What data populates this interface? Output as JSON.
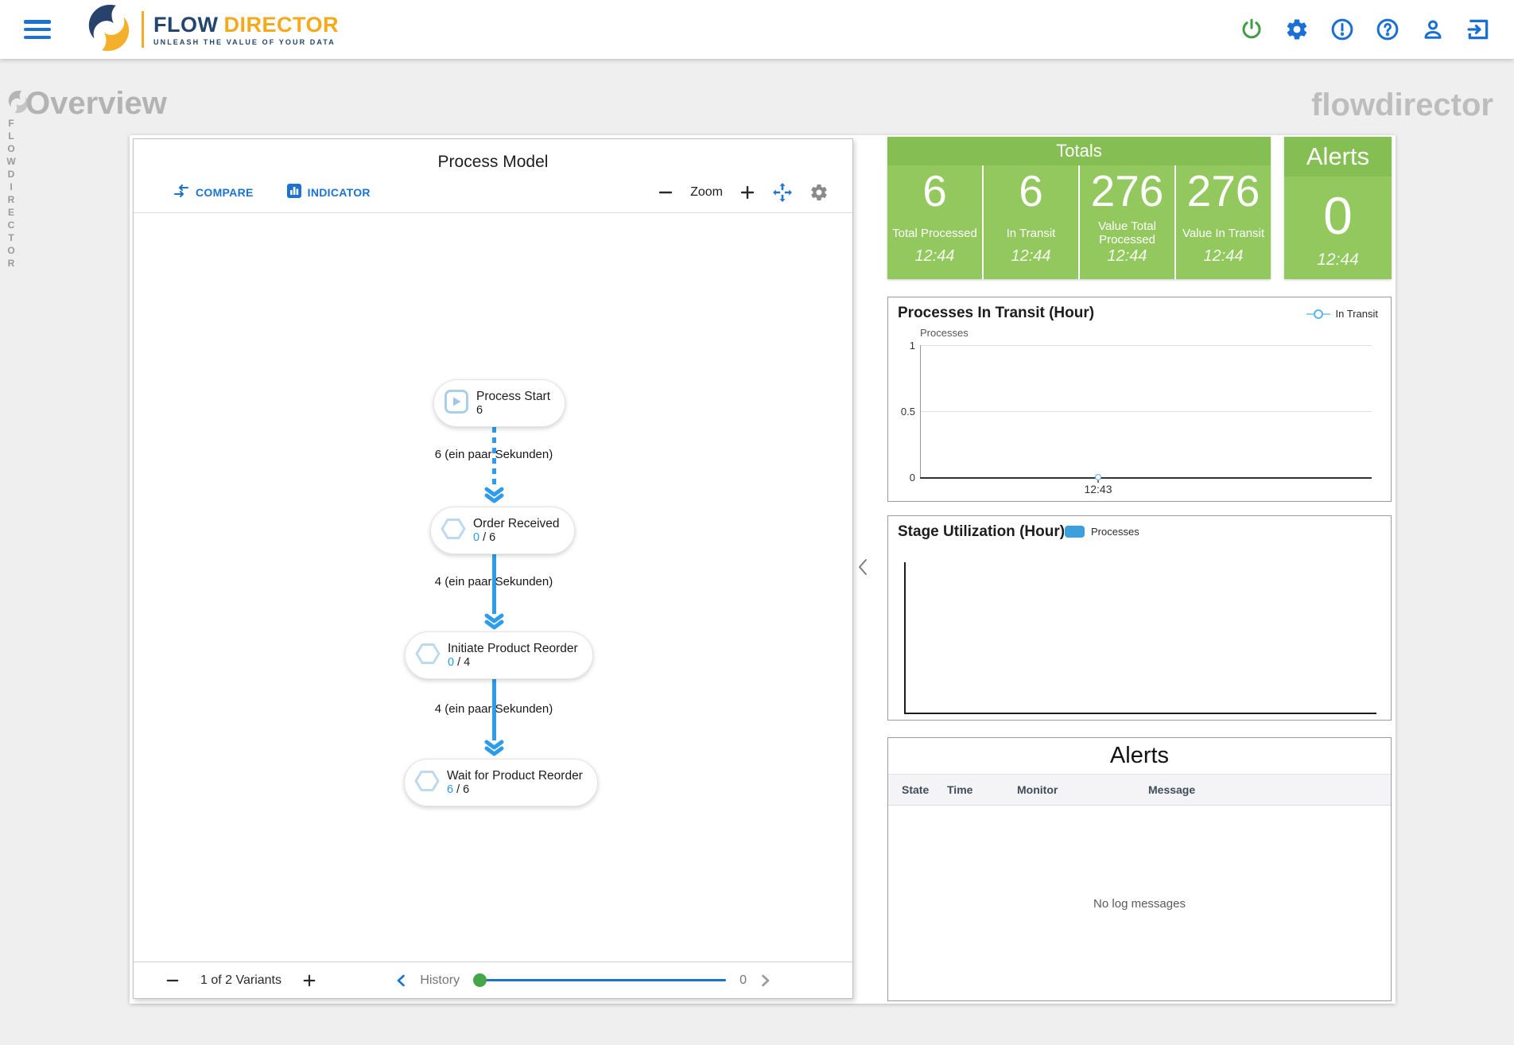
{
  "header": {
    "brand": {
      "word1": "FLOW",
      "word2": "DIRECTOR",
      "tagline": "UNLEASH THE VALUE OF YOUR DATA"
    },
    "action_icons": [
      "power",
      "settings",
      "alert",
      "help",
      "user",
      "logout"
    ]
  },
  "page": {
    "title": "Overview",
    "watermark": "flowdirector",
    "vertical_brand": "FLOWDIRECTOR"
  },
  "process_model": {
    "title": "Process Model",
    "toolbar": {
      "compare_label": "COMPARE",
      "indicator_label": "INDICATOR",
      "zoom_label": "Zoom"
    },
    "count_separator": "/",
    "nodes": [
      {
        "label": "Process Start",
        "count": "6",
        "icon": "play"
      },
      {
        "label": "Order Received",
        "count_active": "0",
        "count_total": "6",
        "icon": "hexagon"
      },
      {
        "label": "Initiate Product Reorder",
        "count_active": "0",
        "count_total": "4",
        "icon": "hexagon"
      },
      {
        "label": "Wait for Product Reorder",
        "count_active": "6",
        "count_total": "6",
        "icon": "hexagon"
      }
    ],
    "edges": [
      {
        "label": "6 (ein paar Sekunden)"
      },
      {
        "label": "4 (ein paar Sekunden)"
      },
      {
        "label": "4 (ein paar Sekunden)"
      }
    ],
    "footer": {
      "variants_label": "1 of 2 Variants",
      "history_label": "History",
      "history_value": "0"
    }
  },
  "totals_panel": {
    "title": "Totals",
    "items": [
      {
        "value": "6",
        "label": "Total Processed",
        "time": "12:44"
      },
      {
        "value": "6",
        "label": "In Transit",
        "time": "12:44"
      },
      {
        "value": "276",
        "label": "Value Total Processed",
        "time": "12:44"
      },
      {
        "value": "276",
        "label": "Value In Transit",
        "time": "12:44"
      }
    ]
  },
  "alerts_panel": {
    "title": "Alerts",
    "value": "0",
    "time": "12:44"
  },
  "chart_data": [
    {
      "type": "line",
      "title": "Processes In Transit (Hour)",
      "ylabel": "Processes",
      "series": [
        {
          "name": "In Transit",
          "x": [
            "12:43"
          ],
          "y": [
            0
          ]
        }
      ],
      "ylim": [
        0,
        1
      ],
      "yticks": [
        "1",
        "0.5",
        "0"
      ],
      "xticks": [
        "12:43"
      ],
      "legend": [
        {
          "label": "In Transit",
          "color": "#5db3ea",
          "marker": "open-circle-line"
        }
      ],
      "legend_position": "top-right",
      "grid": true
    },
    {
      "type": "bar",
      "title": "Stage Utilization (Hour)",
      "categories": [],
      "values": [],
      "legend": [
        {
          "label": "Processes",
          "color": "#3da0dc",
          "marker": "rounded-square"
        }
      ],
      "legend_position": "top-center",
      "grid": false
    }
  ],
  "alerts_table": {
    "title": "Alerts",
    "columns": [
      "State",
      "Time",
      "Monitor",
      "Message"
    ],
    "rows": [],
    "empty_message": "No log messages"
  },
  "colors": {
    "accent_blue": "#1a73d1",
    "flow_blue": "#2f9ceb",
    "green_panel": "#92c85e",
    "green_panel_header": "#85be53",
    "power_green": "#3f9d44"
  }
}
